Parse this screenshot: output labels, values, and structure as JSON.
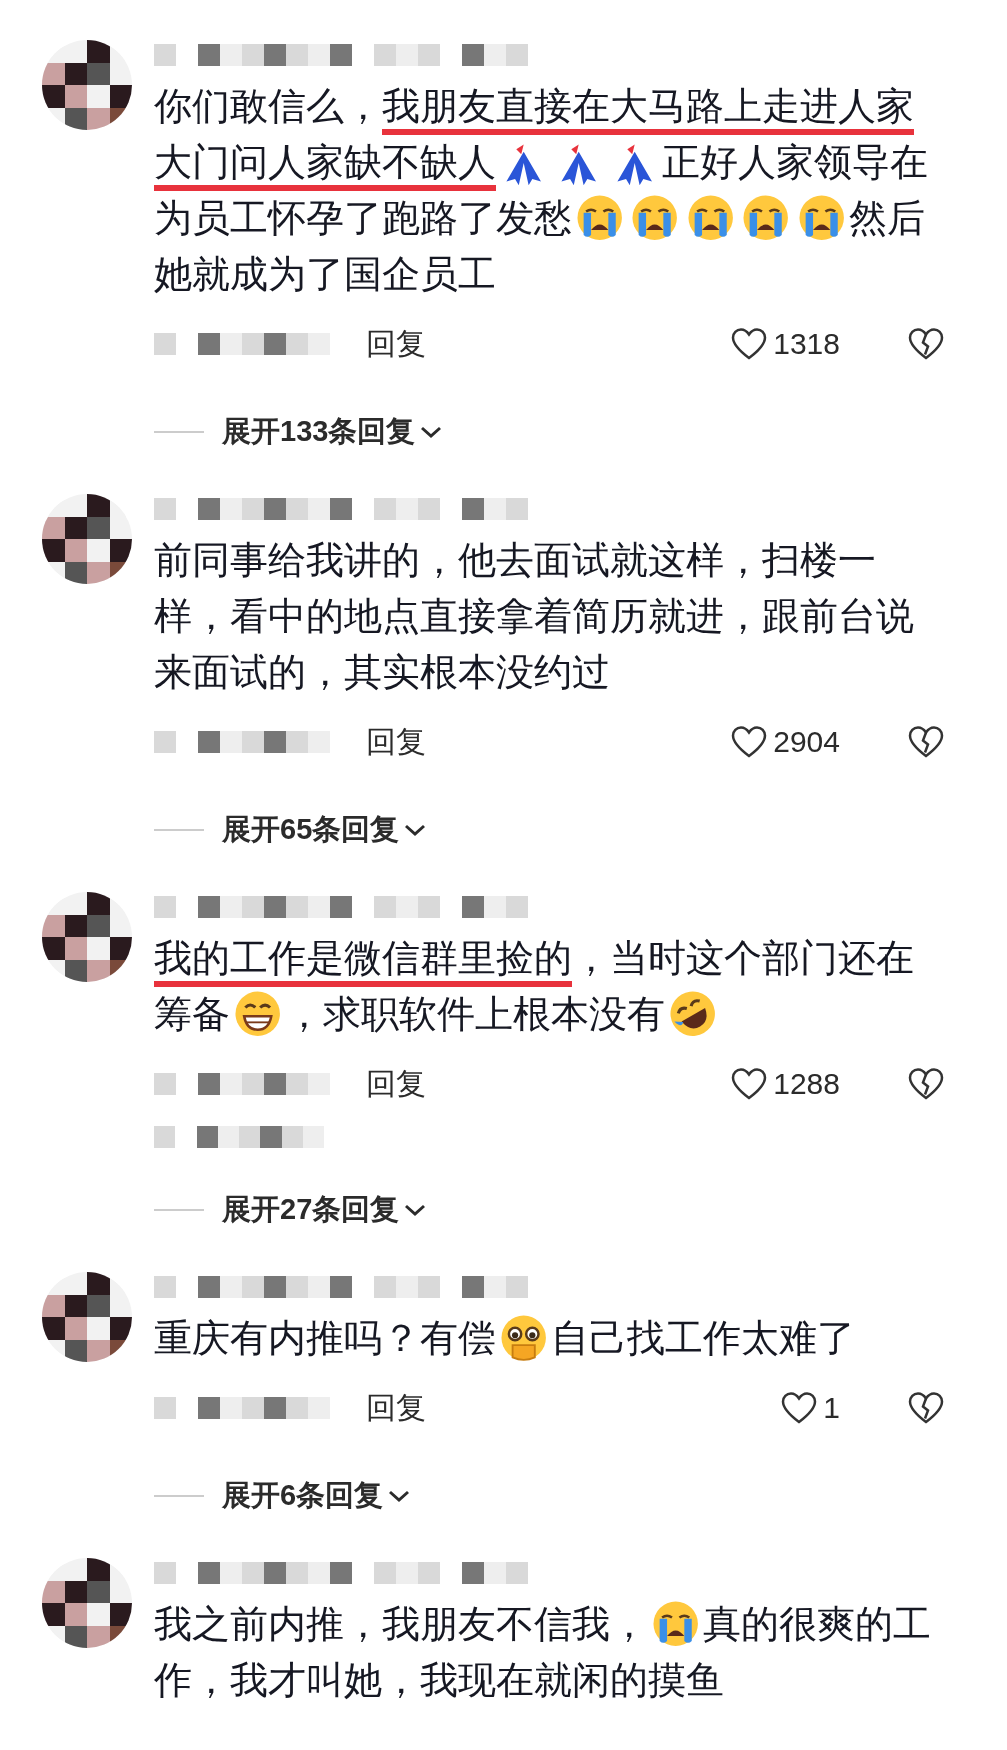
{
  "comments": [
    {
      "lines": [
        [
          {
            "kind": "text",
            "text": "你们敢信么，",
            "marked": false
          },
          {
            "kind": "text",
            "text": "我朋友直接在大马路上走进人家",
            "marked": true
          }
        ],
        [
          {
            "kind": "text",
            "text": "大门问人家缺不缺人",
            "marked": true
          },
          {
            "kind": "ribbon"
          },
          {
            "kind": "ribbon"
          },
          {
            "kind": "ribbon"
          },
          {
            "kind": "text",
            "text": "正好人家领导在",
            "marked": false
          }
        ],
        [
          {
            "kind": "text",
            "text": "为员工怀孕了跑路了发愁",
            "marked": false
          },
          {
            "kind": "cry"
          },
          {
            "kind": "cry"
          },
          {
            "kind": "cry"
          },
          {
            "kind": "cry"
          },
          {
            "kind": "cry"
          },
          {
            "kind": "text",
            "text": "然后",
            "marked": false
          }
        ],
        [
          {
            "kind": "text",
            "text": "她就成为了国企员工",
            "marked": false
          }
        ]
      ],
      "reply_label": "回复",
      "like_count": "1318",
      "expand_label": "展开133条回复",
      "extra_blur": false
    },
    {
      "lines": [
        [
          {
            "kind": "text",
            "text": "前同事给我讲的，他去面试就这样，扫楼一",
            "marked": false
          }
        ],
        [
          {
            "kind": "text",
            "text": "样，看中的地点直接拿着简历就进，跟前台说",
            "marked": false
          }
        ],
        [
          {
            "kind": "text",
            "text": "来面试的，其实根本没约过",
            "marked": false
          }
        ]
      ],
      "reply_label": "回复",
      "like_count": "2904",
      "expand_label": "展开65条回复",
      "extra_blur": false
    },
    {
      "lines": [
        [
          {
            "kind": "text",
            "text": "我的工作是微信群里捡的",
            "marked": true
          },
          {
            "kind": "text",
            "text": "，当时这个部门还在",
            "marked": false
          }
        ],
        [
          {
            "kind": "text",
            "text": "筹备",
            "marked": false
          },
          {
            "kind": "grin"
          },
          {
            "kind": "text",
            "text": "，求职软件上根本没有",
            "marked": false
          },
          {
            "kind": "rofl"
          }
        ]
      ],
      "reply_label": "回复",
      "like_count": "1288",
      "expand_label": "展开27条回复",
      "extra_blur": true
    },
    {
      "lines": [
        [
          {
            "kind": "text",
            "text": "重庆有内推吗？有偿",
            "marked": false
          },
          {
            "kind": "tears"
          },
          {
            "kind": "text",
            "text": " 自己找工作太难了",
            "marked": false
          }
        ]
      ],
      "reply_label": "回复",
      "like_count": "1",
      "expand_label": "展开6条回复",
      "extra_blur": false
    },
    {
      "lines": [
        [
          {
            "kind": "text",
            "text": "我之前内推，我朋友不信我，",
            "marked": false
          },
          {
            "kind": "cry"
          },
          {
            "kind": "text",
            "text": "真的很爽的工",
            "marked": false
          }
        ],
        [
          {
            "kind": "text",
            "text": "作，我才叫她，我现在就闲的摸鱼",
            "marked": false
          }
        ]
      ]
    }
  ]
}
